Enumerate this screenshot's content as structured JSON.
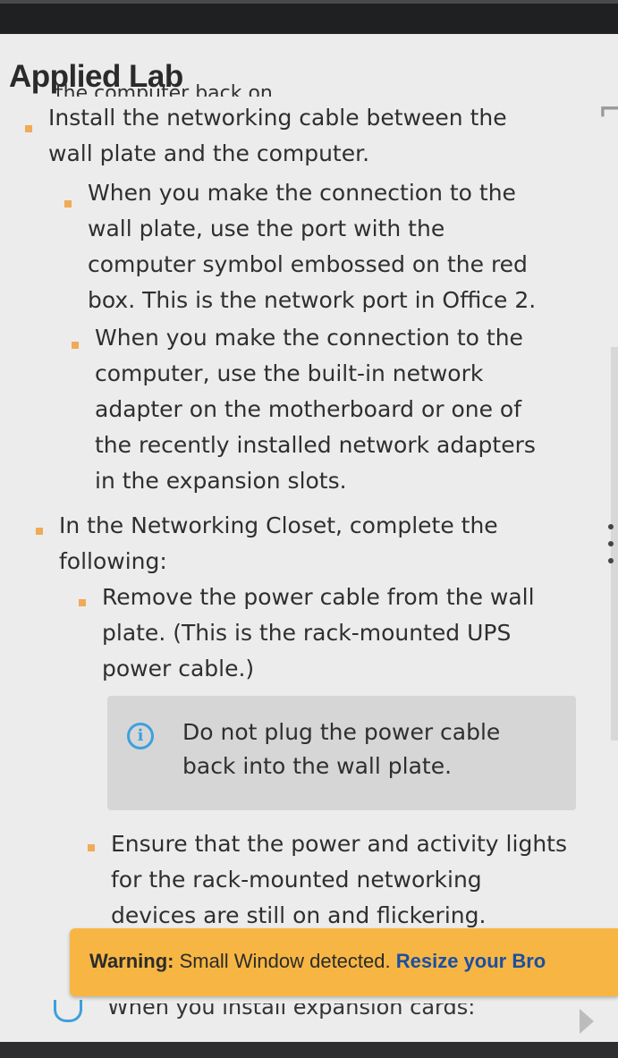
{
  "header": {
    "title": "Applied Lab",
    "clipped_previous_line": "the computer back on."
  },
  "steps": [
    {
      "level": 1,
      "text": "Install the networking cable between the wall plate and the computer.",
      "lines": [
        "Install the networking cable between the",
        "wall plate and the computer."
      ]
    },
    {
      "level": 2,
      "lines": [
        "When you make the connection to the",
        "wall plate, use the port with the",
        "computer symbol embossed on the red",
        "box. This is the network port in Office 2."
      ]
    },
    {
      "level": 2,
      "lines": [
        "When you make the connection to the",
        "computer, use the built-in network",
        "adapter on the motherboard or one of",
        "the recently installed network adapters",
        "in the expansion slots."
      ]
    },
    {
      "level": 1,
      "lines": [
        "In the Networking Closet, complete the",
        "following:"
      ]
    },
    {
      "level": 2,
      "lines": [
        "Remove the power cable from the wall",
        "plate. (This is the rack-mounted UPS",
        "power cable.)"
      ]
    },
    {
      "level": 2,
      "lines": [
        "Ensure that the power and activity lights",
        "for the rack-mounted networking",
        "devices are still on and flickering."
      ]
    }
  ],
  "note": {
    "icon": "info-icon",
    "lines": [
      "Do not plug the power cable",
      "back into the wall plate."
    ]
  },
  "warning": {
    "label": "Warning:",
    "message": " Small Window detected. ",
    "link": "Resize your Bro"
  },
  "clipped_next_line": "When you install expansion cards:",
  "colors": {
    "bullet": "#f1aa55",
    "info": "#3ea0dd",
    "warning_bg": "#f7b643",
    "link": "#1a4fa3",
    "panel_bg": "#ececec"
  }
}
